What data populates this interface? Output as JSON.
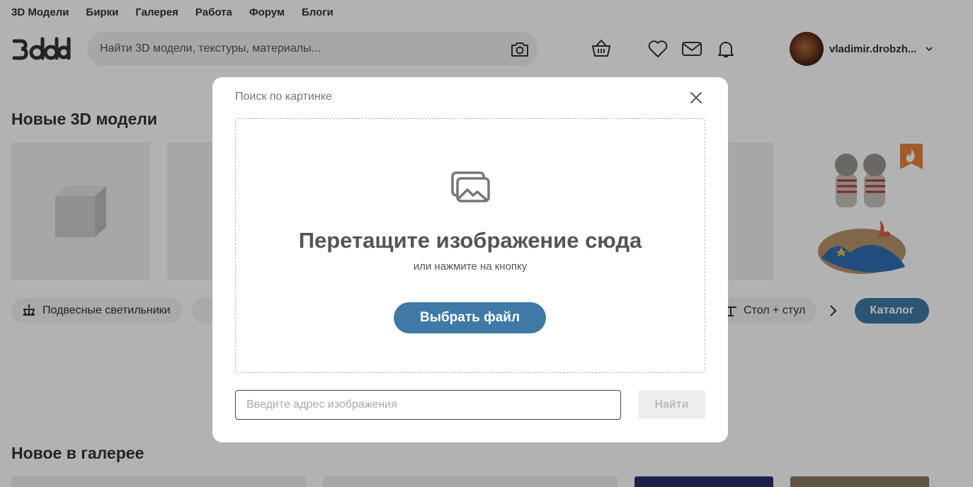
{
  "nav": {
    "items": [
      "3D Модели",
      "Бирки",
      "Галерея",
      "Работа",
      "Форум",
      "Блоги"
    ]
  },
  "search": {
    "placeholder": "Найти 3D модели, текстуры, материалы..."
  },
  "user": {
    "name": "vladimir.drobzh..."
  },
  "sections": {
    "new_models": "Новые 3D модели",
    "new_gallery": "Новое в галерее"
  },
  "chips": {
    "first": "Подвесные светильники",
    "last": "Стол + стул"
  },
  "catalog_label": "Каталог",
  "modal": {
    "title": "Поиск по картинке",
    "drop_title": "Перетащите изображение сюда",
    "drop_sub": "или нажмите на кнопку",
    "choose_label": "Выбрать файл",
    "url_placeholder": "Введите адрес изображения",
    "find_label": "Найти"
  },
  "icons": {
    "header": [
      "camera-icon",
      "basket-icon",
      "heart-icon",
      "mail-icon",
      "bell-icon",
      "chevron-down-icon"
    ],
    "modal": [
      "close-icon",
      "images-icon"
    ]
  },
  "colors": {
    "accent": "#3f7aa6",
    "hot_badge": "#e8843b"
  }
}
